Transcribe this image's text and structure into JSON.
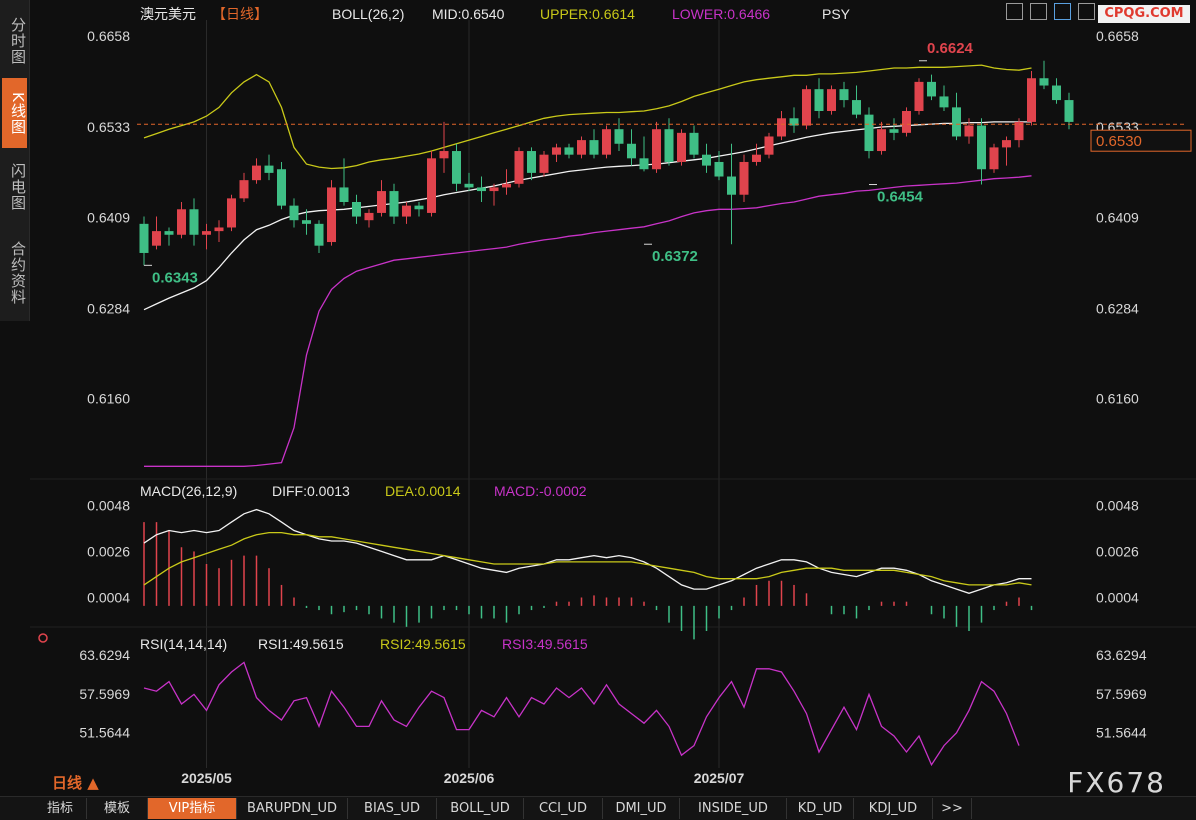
{
  "left_tabs": [
    "分时图",
    "K线图",
    "闪电图",
    "合约资料"
  ],
  "watermark": "CPQG.COM",
  "brand": "FX678",
  "period_label": "日线 ▲",
  "bottom_tabs": [
    "指标",
    "模板",
    "VIP指标",
    "BARUPDN_UD",
    "BIAS_UD",
    "BOLL_UD",
    "CCI_UD",
    "DMI_UD",
    "INSIDE_UD",
    "KD_UD",
    "KDJ_UD",
    ">>"
  ],
  "colors": {
    "up": "#e0444d",
    "down": "#3fbf86",
    "mid": "#f2f2f2",
    "upper": "#c9c919",
    "lower": "#c833c8",
    "rsi": "#c833c8",
    "diff": "#f2f2f2",
    "dea": "#c9c919",
    "accent": "#e2672a",
    "grid": "#2a2a2a"
  },
  "header": {
    "symbol": "澳元美元",
    "period": "【日线】",
    "indicator": "BOLL(26,2)",
    "mid": "MID:0.6540",
    "upper": "UPPER:0.6614",
    "lower": "LOWER:0.6466",
    "psy": "PSY"
  },
  "macd_header": {
    "name": "MACD(26,12,9)",
    "diff": "DIFF:0.0013",
    "dea": "DEA:0.0014",
    "macd": "MACD:-0.0002"
  },
  "rsi_header": {
    "name": "RSI(14,14,14)",
    "rsi1": "RSI1:49.5615",
    "rsi2": "RSI2:49.5615",
    "rsi3": "RSI3:49.5615"
  },
  "chart_data": [
    {
      "type": "candlestick",
      "title": "澳元美元【日线】 BOLL(26,2)",
      "ylim": [
        0.6055,
        0.668
      ],
      "yticks": [
        0.6658,
        0.6533,
        0.6409,
        0.6284,
        0.616
      ],
      "ytick_labels_right_extra": [
        "0.6658",
        "0.6533",
        "0.6409",
        "0.6284",
        "0.6160"
      ],
      "current_price": "0.6530",
      "xlabels": [
        "2025/05",
        "2025/06",
        "2025/07"
      ],
      "xlabel_index": [
        5,
        26,
        46
      ],
      "annotations": [
        {
          "text": "0.6343",
          "index": 0,
          "value": 0.6343,
          "color": "down"
        },
        {
          "text": "0.6372",
          "index": 40,
          "value": 0.6372,
          "color": "down"
        },
        {
          "text": "0.6454",
          "index": 58,
          "value": 0.6454,
          "color": "down"
        },
        {
          "text": "0.6624",
          "index": 62,
          "value": 0.6624,
          "color": "up"
        }
      ],
      "ohlc": [
        [
          0.64,
          0.641,
          0.6343,
          0.636
        ],
        [
          0.637,
          0.641,
          0.6365,
          0.639
        ],
        [
          0.639,
          0.6395,
          0.637,
          0.6385
        ],
        [
          0.6385,
          0.643,
          0.638,
          0.642
        ],
        [
          0.642,
          0.6435,
          0.637,
          0.6385
        ],
        [
          0.6385,
          0.64,
          0.6365,
          0.639
        ],
        [
          0.639,
          0.6405,
          0.6375,
          0.6395
        ],
        [
          0.6395,
          0.644,
          0.639,
          0.6435
        ],
        [
          0.6435,
          0.647,
          0.643,
          0.646
        ],
        [
          0.646,
          0.649,
          0.6455,
          0.648
        ],
        [
          0.648,
          0.6495,
          0.646,
          0.647
        ],
        [
          0.6475,
          0.6485,
          0.642,
          0.6425
        ],
        [
          0.6425,
          0.6435,
          0.6395,
          0.6405
        ],
        [
          0.6405,
          0.642,
          0.6385,
          0.64
        ],
        [
          0.64,
          0.6405,
          0.636,
          0.637
        ],
        [
          0.6375,
          0.646,
          0.637,
          0.645
        ],
        [
          0.645,
          0.649,
          0.6425,
          0.643
        ],
        [
          0.643,
          0.644,
          0.64,
          0.641
        ],
        [
          0.6405,
          0.642,
          0.6395,
          0.6415
        ],
        [
          0.6415,
          0.646,
          0.641,
          0.6445
        ],
        [
          0.6445,
          0.6455,
          0.64,
          0.641
        ],
        [
          0.641,
          0.643,
          0.64,
          0.6425
        ],
        [
          0.6425,
          0.643,
          0.641,
          0.642
        ],
        [
          0.6415,
          0.65,
          0.641,
          0.649
        ],
        [
          0.649,
          0.654,
          0.647,
          0.65
        ],
        [
          0.65,
          0.651,
          0.6445,
          0.6455
        ],
        [
          0.6455,
          0.647,
          0.6445,
          0.645
        ],
        [
          0.645,
          0.6465,
          0.643,
          0.6445
        ],
        [
          0.6445,
          0.6455,
          0.6425,
          0.645
        ],
        [
          0.645,
          0.6475,
          0.644,
          0.6455
        ],
        [
          0.6455,
          0.6505,
          0.645,
          0.65
        ],
        [
          0.65,
          0.6505,
          0.646,
          0.647
        ],
        [
          0.647,
          0.65,
          0.6465,
          0.6495
        ],
        [
          0.6495,
          0.651,
          0.6485,
          0.6505
        ],
        [
          0.6505,
          0.651,
          0.649,
          0.6495
        ],
        [
          0.6495,
          0.652,
          0.649,
          0.6515
        ],
        [
          0.6515,
          0.653,
          0.649,
          0.6495
        ],
        [
          0.6495,
          0.6535,
          0.649,
          0.653
        ],
        [
          0.653,
          0.6545,
          0.65,
          0.651
        ],
        [
          0.651,
          0.653,
          0.648,
          0.649
        ],
        [
          0.649,
          0.652,
          0.6472,
          0.6475
        ],
        [
          0.6475,
          0.654,
          0.647,
          0.653
        ],
        [
          0.653,
          0.6545,
          0.648,
          0.6485
        ],
        [
          0.6485,
          0.653,
          0.648,
          0.6525
        ],
        [
          0.6525,
          0.6535,
          0.649,
          0.6495
        ],
        [
          0.6495,
          0.651,
          0.647,
          0.648
        ],
        [
          0.6485,
          0.65,
          0.646,
          0.6465
        ],
        [
          0.6465,
          0.651,
          0.6372,
          0.644
        ],
        [
          0.644,
          0.6495,
          0.643,
          0.6485
        ],
        [
          0.6485,
          0.651,
          0.648,
          0.6495
        ],
        [
          0.6495,
          0.6525,
          0.649,
          0.652
        ],
        [
          0.652,
          0.6555,
          0.6515,
          0.6545
        ],
        [
          0.6545,
          0.656,
          0.6525,
          0.6535
        ],
        [
          0.6535,
          0.659,
          0.653,
          0.6585
        ],
        [
          0.6585,
          0.66,
          0.6545,
          0.6555
        ],
        [
          0.6555,
          0.659,
          0.655,
          0.6585
        ],
        [
          0.6585,
          0.6595,
          0.656,
          0.657
        ],
        [
          0.657,
          0.659,
          0.6545,
          0.655
        ],
        [
          0.655,
          0.656,
          0.649,
          0.65
        ],
        [
          0.65,
          0.654,
          0.6495,
          0.653
        ],
        [
          0.653,
          0.6545,
          0.6515,
          0.6525
        ],
        [
          0.6525,
          0.656,
          0.652,
          0.6555
        ],
        [
          0.6555,
          0.66,
          0.655,
          0.6595
        ],
        [
          0.6595,
          0.6605,
          0.657,
          0.6575
        ],
        [
          0.6575,
          0.659,
          0.6555,
          0.656
        ],
        [
          0.656,
          0.658,
          0.6515,
          0.652
        ],
        [
          0.652,
          0.6545,
          0.651,
          0.6535
        ],
        [
          0.6535,
          0.6545,
          0.6454,
          0.6475
        ],
        [
          0.6475,
          0.651,
          0.647,
          0.6505
        ],
        [
          0.6505,
          0.652,
          0.648,
          0.6515
        ],
        [
          0.6515,
          0.6545,
          0.6505,
          0.654
        ],
        [
          0.654,
          0.661,
          0.6535,
          0.66
        ],
        [
          0.66,
          0.6624,
          0.6585,
          0.659
        ],
        [
          0.659,
          0.66,
          0.6565,
          0.657
        ],
        [
          0.657,
          0.658,
          0.653,
          0.654
        ]
      ],
      "boll_mid": [
        0.6282,
        0.629,
        0.6298,
        0.6305,
        0.6312,
        0.6322,
        0.634,
        0.636,
        0.6378,
        0.6392,
        0.6398,
        0.6406,
        0.6412,
        0.6416,
        0.6418,
        0.6419,
        0.642,
        0.6422,
        0.6424,
        0.6426,
        0.6428,
        0.643,
        0.6433,
        0.6436,
        0.644,
        0.6443,
        0.6446,
        0.6449,
        0.6452,
        0.6456,
        0.646,
        0.6463,
        0.6466,
        0.6469,
        0.6472,
        0.6474,
        0.6476,
        0.6478,
        0.6479,
        0.648,
        0.6481,
        0.6482,
        0.6484,
        0.6486,
        0.6488,
        0.649,
        0.6493,
        0.6496,
        0.6499,
        0.6503,
        0.6507,
        0.6511,
        0.6515,
        0.6519,
        0.6522,
        0.6525,
        0.6527,
        0.6529,
        0.6531,
        0.6533,
        0.6534,
        0.6535,
        0.6536,
        0.6537,
        0.6538,
        0.6538,
        0.6539,
        0.6539,
        0.654,
        0.654,
        0.654,
        0.654
      ],
      "boll_upper": [
        0.6518,
        0.6524,
        0.653,
        0.6535,
        0.654,
        0.6548,
        0.656,
        0.658,
        0.6595,
        0.6605,
        0.6595,
        0.656,
        0.6505,
        0.6482,
        0.6478,
        0.6476,
        0.6477,
        0.648,
        0.6485,
        0.6488,
        0.649,
        0.6493,
        0.6496,
        0.65,
        0.6505,
        0.651,
        0.6515,
        0.652,
        0.6525,
        0.653,
        0.6535,
        0.654,
        0.6545,
        0.6548,
        0.655,
        0.6551,
        0.6552,
        0.6553,
        0.6553,
        0.6554,
        0.6555,
        0.6558,
        0.6562,
        0.6568,
        0.6575,
        0.658,
        0.6585,
        0.659,
        0.6595,
        0.6598,
        0.66,
        0.6602,
        0.6604,
        0.6604,
        0.6606,
        0.6606,
        0.6607,
        0.6608,
        0.661,
        0.6612,
        0.6614,
        0.6614,
        0.6615,
        0.6615,
        0.6615,
        0.6616,
        0.6617,
        0.6618,
        0.6614,
        0.6612,
        0.6611,
        0.6614
      ],
      "boll_lower": [
        0.6067,
        0.6067,
        0.6067,
        0.6067,
        0.6067,
        0.6067,
        0.6067,
        0.6067,
        0.6067,
        0.6068,
        0.607,
        0.6072,
        0.612,
        0.622,
        0.628,
        0.631,
        0.6325,
        0.6335,
        0.634,
        0.6345,
        0.635,
        0.6352,
        0.6354,
        0.6356,
        0.6358,
        0.636,
        0.6362,
        0.6364,
        0.6366,
        0.6368,
        0.6372,
        0.6375,
        0.6378,
        0.638,
        0.6383,
        0.6385,
        0.6388,
        0.639,
        0.6392,
        0.6394,
        0.6396,
        0.64,
        0.6404,
        0.641,
        0.6415,
        0.6418,
        0.642,
        0.642,
        0.6421,
        0.6422,
        0.6425,
        0.6428,
        0.643,
        0.6434,
        0.6438,
        0.644,
        0.6442,
        0.6445,
        0.6446,
        0.6448,
        0.645,
        0.6452,
        0.6453,
        0.6454,
        0.6455,
        0.6456,
        0.6458,
        0.646,
        0.6462,
        0.6463,
        0.6464,
        0.6466
      ]
    },
    {
      "type": "line+bar",
      "title": "MACD(26,12,9)",
      "ylim": [
        -0.0012,
        0.0052
      ],
      "yticks": [
        0.0048,
        0.0026,
        0.0004
      ],
      "diff": [
        0.003,
        0.0034,
        0.0036,
        0.0035,
        0.0036,
        0.0035,
        0.0036,
        0.004,
        0.0044,
        0.0046,
        0.0044,
        0.004,
        0.0036,
        0.0034,
        0.0032,
        0.0031,
        0.0031,
        0.003,
        0.0028,
        0.0026,
        0.0024,
        0.0022,
        0.0022,
        0.0022,
        0.0024,
        0.0022,
        0.002,
        0.0018,
        0.0017,
        0.0016,
        0.0018,
        0.0019,
        0.002,
        0.0022,
        0.0022,
        0.0023,
        0.0024,
        0.0023,
        0.0024,
        0.0023,
        0.0021,
        0.0018,
        0.0014,
        0.001,
        0.0008,
        0.0008,
        0.001,
        0.0012,
        0.0015,
        0.0018,
        0.002,
        0.0022,
        0.0022,
        0.0021,
        0.0018,
        0.0016,
        0.0015,
        0.0014,
        0.0016,
        0.0018,
        0.0018,
        0.0017,
        0.0015,
        0.0012,
        0.001,
        0.0008,
        0.0006,
        0.0008,
        0.001,
        0.0011,
        0.0013,
        0.0013
      ],
      "dea": [
        0.001,
        0.0014,
        0.0018,
        0.0021,
        0.0023,
        0.0025,
        0.0027,
        0.0029,
        0.0032,
        0.0034,
        0.0035,
        0.0035,
        0.0034,
        0.0034,
        0.0033,
        0.0033,
        0.0032,
        0.0031,
        0.003,
        0.0029,
        0.0028,
        0.0027,
        0.0026,
        0.0025,
        0.0024,
        0.0023,
        0.0022,
        0.0021,
        0.002,
        0.002,
        0.002,
        0.002,
        0.002,
        0.0021,
        0.0021,
        0.0021,
        0.0021,
        0.0021,
        0.0021,
        0.0021,
        0.002,
        0.0019,
        0.0018,
        0.0017,
        0.0016,
        0.0014,
        0.0013,
        0.0013,
        0.0013,
        0.0013,
        0.0014,
        0.0016,
        0.0017,
        0.0018,
        0.0018,
        0.0018,
        0.0017,
        0.0017,
        0.0017,
        0.0017,
        0.0017,
        0.0016,
        0.0015,
        0.0014,
        0.0012,
        0.0011,
        0.001,
        0.001,
        0.001,
        0.001,
        0.0011,
        0.001
      ],
      "macd": [
        0.004,
        0.004,
        0.0036,
        0.0028,
        0.0026,
        0.002,
        0.0018,
        0.0022,
        0.0024,
        0.0024,
        0.0018,
        0.001,
        0.0004,
        -0.0001,
        -0.0002,
        -0.0004,
        -0.0003,
        -0.0002,
        -0.0004,
        -0.0006,
        -0.0008,
        -0.001,
        -0.0008,
        -0.0006,
        -0.0002,
        -0.0002,
        -0.0004,
        -0.0006,
        -0.0006,
        -0.0008,
        -0.0004,
        -0.0002,
        -0.0001,
        0.0002,
        0.0002,
        0.0004,
        0.0005,
        0.0004,
        0.0004,
        0.0004,
        0.0002,
        -0.0002,
        -0.0008,
        -0.0012,
        -0.0016,
        -0.0012,
        -0.0006,
        -0.0002,
        0.0004,
        0.001,
        0.0012,
        0.0012,
        0.001,
        0.0006,
        0.0,
        -0.0004,
        -0.0004,
        -0.0006,
        -0.0002,
        0.0002,
        0.0002,
        0.0002,
        0.0,
        -0.0004,
        -0.0006,
        -0.001,
        -0.0012,
        -0.0008,
        -0.0002,
        0.0002,
        0.0004,
        -0.0002
      ]
    },
    {
      "type": "line",
      "title": "RSI(14,14,14)",
      "ylim": [
        46.0,
        66.0
      ],
      "yticks": [
        63.6294,
        57.5969,
        51.5644
      ],
      "rsi": [
        58.5,
        58.0,
        59.5,
        56.0,
        57.5,
        55.0,
        59.0,
        61.0,
        62.5,
        57.0,
        55.0,
        53.5,
        56.5,
        57.0,
        52.5,
        58.0,
        55.5,
        52.5,
        52.5,
        56.5,
        53.5,
        52.5,
        55.5,
        58.0,
        57.0,
        52.0,
        52.0,
        55.0,
        54.0,
        57.0,
        54.0,
        57.0,
        56.0,
        58.5,
        57.0,
        58.5,
        56.0,
        59.0,
        56.0,
        54.5,
        53.0,
        55.0,
        52.5,
        48.0,
        49.5,
        54.0,
        57.0,
        59.5,
        55.5,
        61.5,
        61.5,
        61.0,
        58.0,
        54.5,
        48.5,
        52.0,
        55.5,
        52.0,
        57.5,
        52.5,
        51.0,
        48.5,
        51.0,
        46.5,
        49.5,
        51.5,
        55.0,
        59.5,
        58.0,
        54.5,
        49.5
      ]
    }
  ]
}
